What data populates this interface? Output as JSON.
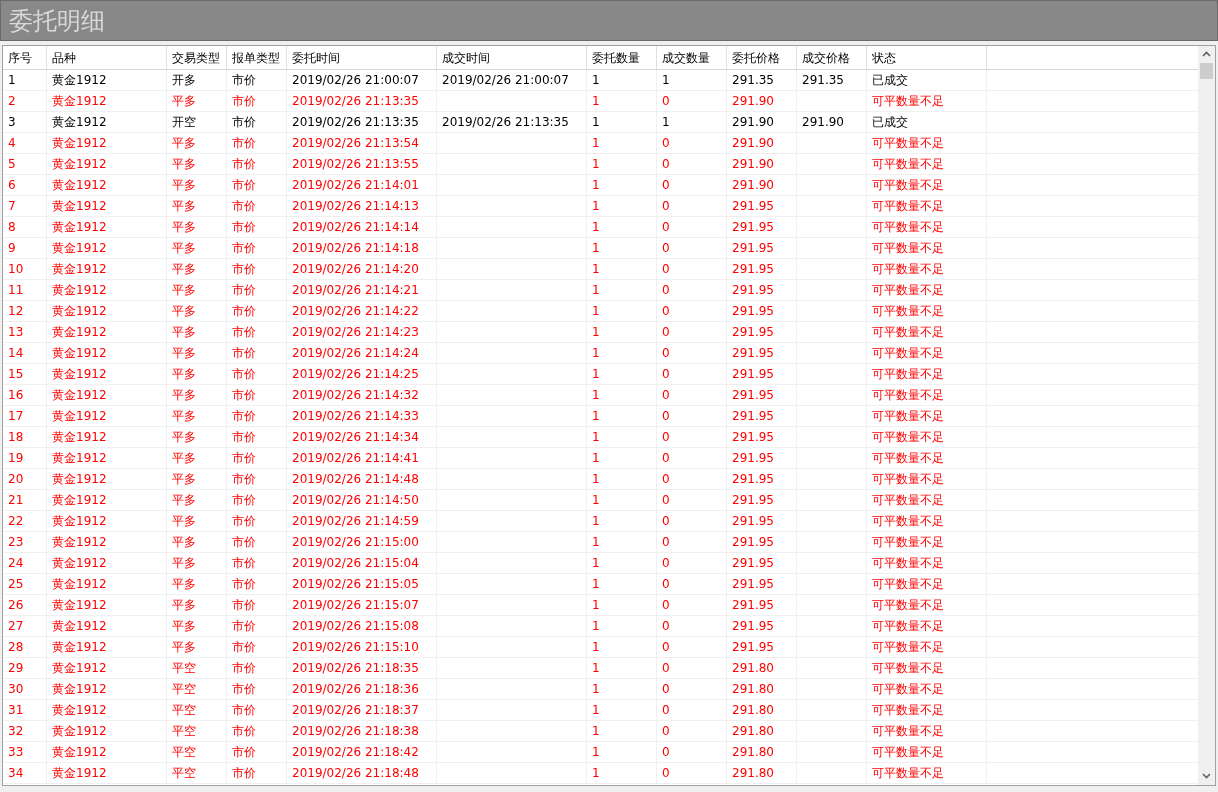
{
  "window": {
    "title": "委托明细"
  },
  "table": {
    "columns": [
      "序号",
      "品种",
      "交易类型",
      "报单类型",
      "委托时间",
      "成交时间",
      "委托数量",
      "成交数量",
      "委托价格",
      "成交价格",
      "状态"
    ],
    "rows": [
      {
        "color": "#000000",
        "cells": [
          "1",
          "黄金1912",
          "开多",
          "市价",
          "2019/02/26 21:00:07",
          "2019/02/26 21:00:07",
          "1",
          "1",
          "291.35",
          "291.35",
          "已成交"
        ]
      },
      {
        "color": "#ff0000",
        "cells": [
          "2",
          "黄金1912",
          "平多",
          "市价",
          "2019/02/26 21:13:35",
          "",
          "1",
          "0",
          "291.90",
          "",
          "可平数量不足"
        ]
      },
      {
        "color": "#000000",
        "cells": [
          "3",
          "黄金1912",
          "开空",
          "市价",
          "2019/02/26 21:13:35",
          "2019/02/26 21:13:35",
          "1",
          "1",
          "291.90",
          "291.90",
          "已成交"
        ]
      },
      {
        "color": "#ff0000",
        "cells": [
          "4",
          "黄金1912",
          "平多",
          "市价",
          "2019/02/26 21:13:54",
          "",
          "1",
          "0",
          "291.90",
          "",
          "可平数量不足"
        ]
      },
      {
        "color": "#ff0000",
        "cells": [
          "5",
          "黄金1912",
          "平多",
          "市价",
          "2019/02/26 21:13:55",
          "",
          "1",
          "0",
          "291.90",
          "",
          "可平数量不足"
        ]
      },
      {
        "color": "#ff0000",
        "cells": [
          "6",
          "黄金1912",
          "平多",
          "市价",
          "2019/02/26 21:14:01",
          "",
          "1",
          "0",
          "291.90",
          "",
          "可平数量不足"
        ]
      },
      {
        "color": "#ff0000",
        "cells": [
          "7",
          "黄金1912",
          "平多",
          "市价",
          "2019/02/26 21:14:13",
          "",
          "1",
          "0",
          "291.95",
          "",
          "可平数量不足"
        ]
      },
      {
        "color": "#ff0000",
        "cells": [
          "8",
          "黄金1912",
          "平多",
          "市价",
          "2019/02/26 21:14:14",
          "",
          "1",
          "0",
          "291.95",
          "",
          "可平数量不足"
        ]
      },
      {
        "color": "#ff0000",
        "cells": [
          "9",
          "黄金1912",
          "平多",
          "市价",
          "2019/02/26 21:14:18",
          "",
          "1",
          "0",
          "291.95",
          "",
          "可平数量不足"
        ]
      },
      {
        "color": "#ff0000",
        "cells": [
          "10",
          "黄金1912",
          "平多",
          "市价",
          "2019/02/26 21:14:20",
          "",
          "1",
          "0",
          "291.95",
          "",
          "可平数量不足"
        ]
      },
      {
        "color": "#ff0000",
        "cells": [
          "11",
          "黄金1912",
          "平多",
          "市价",
          "2019/02/26 21:14:21",
          "",
          "1",
          "0",
          "291.95",
          "",
          "可平数量不足"
        ]
      },
      {
        "color": "#ff0000",
        "cells": [
          "12",
          "黄金1912",
          "平多",
          "市价",
          "2019/02/26 21:14:22",
          "",
          "1",
          "0",
          "291.95",
          "",
          "可平数量不足"
        ]
      },
      {
        "color": "#ff0000",
        "cells": [
          "13",
          "黄金1912",
          "平多",
          "市价",
          "2019/02/26 21:14:23",
          "",
          "1",
          "0",
          "291.95",
          "",
          "可平数量不足"
        ]
      },
      {
        "color": "#ff0000",
        "cells": [
          "14",
          "黄金1912",
          "平多",
          "市价",
          "2019/02/26 21:14:24",
          "",
          "1",
          "0",
          "291.95",
          "",
          "可平数量不足"
        ]
      },
      {
        "color": "#ff0000",
        "cells": [
          "15",
          "黄金1912",
          "平多",
          "市价",
          "2019/02/26 21:14:25",
          "",
          "1",
          "0",
          "291.95",
          "",
          "可平数量不足"
        ]
      },
      {
        "color": "#ff0000",
        "cells": [
          "16",
          "黄金1912",
          "平多",
          "市价",
          "2019/02/26 21:14:32",
          "",
          "1",
          "0",
          "291.95",
          "",
          "可平数量不足"
        ]
      },
      {
        "color": "#ff0000",
        "cells": [
          "17",
          "黄金1912",
          "平多",
          "市价",
          "2019/02/26 21:14:33",
          "",
          "1",
          "0",
          "291.95",
          "",
          "可平数量不足"
        ]
      },
      {
        "color": "#ff0000",
        "cells": [
          "18",
          "黄金1912",
          "平多",
          "市价",
          "2019/02/26 21:14:34",
          "",
          "1",
          "0",
          "291.95",
          "",
          "可平数量不足"
        ]
      },
      {
        "color": "#ff0000",
        "cells": [
          "19",
          "黄金1912",
          "平多",
          "市价",
          "2019/02/26 21:14:41",
          "",
          "1",
          "0",
          "291.95",
          "",
          "可平数量不足"
        ]
      },
      {
        "color": "#ff0000",
        "cells": [
          "20",
          "黄金1912",
          "平多",
          "市价",
          "2019/02/26 21:14:48",
          "",
          "1",
          "0",
          "291.95",
          "",
          "可平数量不足"
        ]
      },
      {
        "color": "#ff0000",
        "cells": [
          "21",
          "黄金1912",
          "平多",
          "市价",
          "2019/02/26 21:14:50",
          "",
          "1",
          "0",
          "291.95",
          "",
          "可平数量不足"
        ]
      },
      {
        "color": "#ff0000",
        "cells": [
          "22",
          "黄金1912",
          "平多",
          "市价",
          "2019/02/26 21:14:59",
          "",
          "1",
          "0",
          "291.95",
          "",
          "可平数量不足"
        ]
      },
      {
        "color": "#ff0000",
        "cells": [
          "23",
          "黄金1912",
          "平多",
          "市价",
          "2019/02/26 21:15:00",
          "",
          "1",
          "0",
          "291.95",
          "",
          "可平数量不足"
        ]
      },
      {
        "color": "#ff0000",
        "cells": [
          "24",
          "黄金1912",
          "平多",
          "市价",
          "2019/02/26 21:15:04",
          "",
          "1",
          "0",
          "291.95",
          "",
          "可平数量不足"
        ]
      },
      {
        "color": "#ff0000",
        "cells": [
          "25",
          "黄金1912",
          "平多",
          "市价",
          "2019/02/26 21:15:05",
          "",
          "1",
          "0",
          "291.95",
          "",
          "可平数量不足"
        ]
      },
      {
        "color": "#ff0000",
        "cells": [
          "26",
          "黄金1912",
          "平多",
          "市价",
          "2019/02/26 21:15:07",
          "",
          "1",
          "0",
          "291.95",
          "",
          "可平数量不足"
        ]
      },
      {
        "color": "#ff0000",
        "cells": [
          "27",
          "黄金1912",
          "平多",
          "市价",
          "2019/02/26 21:15:08",
          "",
          "1",
          "0",
          "291.95",
          "",
          "可平数量不足"
        ]
      },
      {
        "color": "#ff0000",
        "cells": [
          "28",
          "黄金1912",
          "平多",
          "市价",
          "2019/02/26 21:15:10",
          "",
          "1",
          "0",
          "291.95",
          "",
          "可平数量不足"
        ]
      },
      {
        "color": "#ff0000",
        "cells": [
          "29",
          "黄金1912",
          "平空",
          "市价",
          "2019/02/26 21:18:35",
          "",
          "1",
          "0",
          "291.80",
          "",
          "可平数量不足"
        ]
      },
      {
        "color": "#ff0000",
        "cells": [
          "30",
          "黄金1912",
          "平空",
          "市价",
          "2019/02/26 21:18:36",
          "",
          "1",
          "0",
          "291.80",
          "",
          "可平数量不足"
        ]
      },
      {
        "color": "#ff0000",
        "cells": [
          "31",
          "黄金1912",
          "平空",
          "市价",
          "2019/02/26 21:18:37",
          "",
          "1",
          "0",
          "291.80",
          "",
          "可平数量不足"
        ]
      },
      {
        "color": "#ff0000",
        "cells": [
          "32",
          "黄金1912",
          "平空",
          "市价",
          "2019/02/26 21:18:38",
          "",
          "1",
          "0",
          "291.80",
          "",
          "可平数量不足"
        ]
      },
      {
        "color": "#ff0000",
        "cells": [
          "33",
          "黄金1912",
          "平空",
          "市价",
          "2019/02/26 21:18:42",
          "",
          "1",
          "0",
          "291.80",
          "",
          "可平数量不足"
        ]
      },
      {
        "color": "#ff0000",
        "cells": [
          "34",
          "黄金1912",
          "平空",
          "市价",
          "2019/02/26 21:18:48",
          "",
          "1",
          "0",
          "291.80",
          "",
          "可平数量不足"
        ]
      }
    ]
  }
}
